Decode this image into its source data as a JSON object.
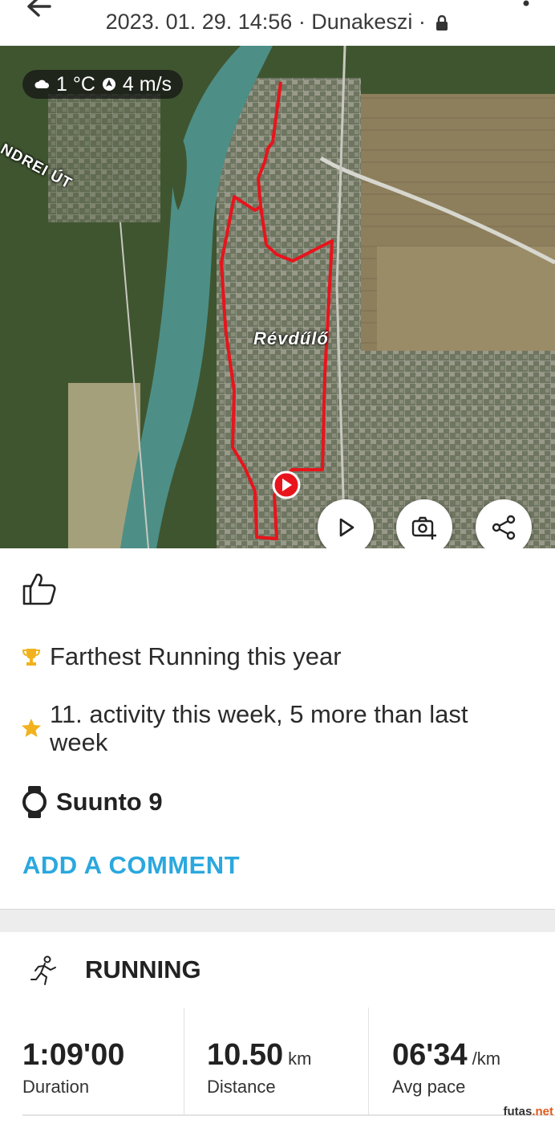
{
  "header": {
    "subtitle": "2023. 01. 29. 14:56 · Dunakeszi ·",
    "back_icon": "arrow-left-icon",
    "menu_icon": "more-vertical-icon",
    "lock_icon": "lock-icon"
  },
  "map": {
    "weather": {
      "temp": "1 °C",
      "wind": "4 m/s",
      "icons": [
        "cloud-icon",
        "wind-icon"
      ]
    },
    "labels": {
      "road": "NDREI ÚT",
      "place": "Révdűlő"
    },
    "route_color": "#e8141c",
    "buttons": [
      "play-icon",
      "add-photo-icon",
      "share-icon"
    ]
  },
  "achievements": [
    {
      "icon": "trophy-icon",
      "text": "Farthest Running this year",
      "color": "#f2b21d"
    },
    {
      "icon": "star-icon",
      "text": "11. activity this week, 5 more than last week",
      "color": "#f2b21d"
    }
  ],
  "device": {
    "icon": "watch-icon",
    "name": "Suunto 9"
  },
  "comment_label": "ADD A COMMENT",
  "activity": {
    "icon": "running-icon",
    "title": "RUNNING"
  },
  "stats": [
    {
      "value": "1:09'00",
      "unit": "",
      "label": "Duration"
    },
    {
      "value": "10.50",
      "unit": "km",
      "label": "Distance"
    },
    {
      "value": "06'34",
      "unit": "/km",
      "label": "Avg pace"
    }
  ],
  "watermark": {
    "text": "futas",
    "suffix": ".net"
  },
  "colors": {
    "accent": "#2aa8de",
    "badge": "#f2b21d"
  }
}
